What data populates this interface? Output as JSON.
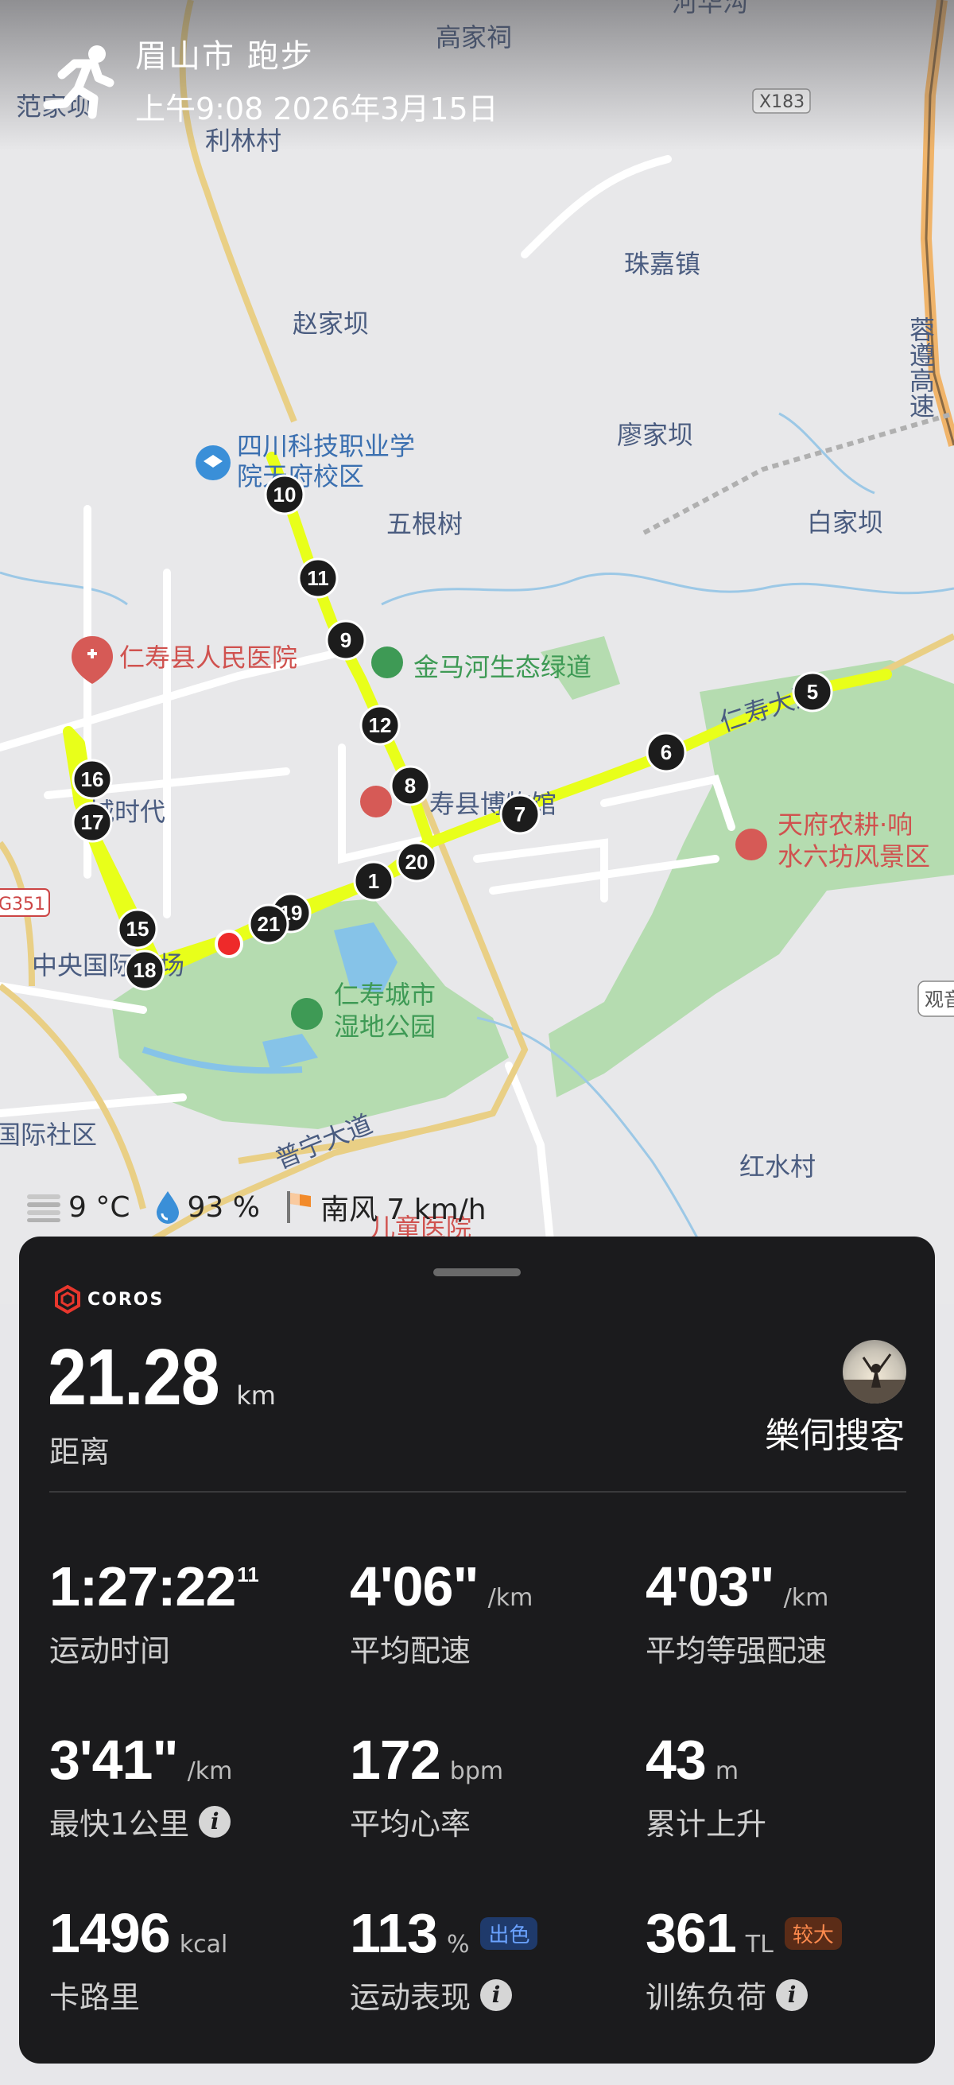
{
  "header": {
    "title": "眉山市 跑步",
    "datetime": "上午9:08 2026年3月15日"
  },
  "map": {
    "place_labels": [
      "高家祠",
      "河华沟",
      "范家坝",
      "利林村",
      "X183",
      "珠嘉镇",
      "赵家坝",
      "蓉遵高速",
      "四川科技职业学",
      "院天府校区",
      "廖家坝",
      "五根树",
      "白家坝",
      "仁寿县人民医院",
      "金马河生态绿道",
      "仁寿大道",
      "城时代",
      "寿县博物馆",
      "天府农耕·响",
      "水六坊风景区",
      "G351",
      "中央国际广场",
      "仁寿城市",
      "湿地公园",
      "观音",
      "国际社区",
      "普宁大道",
      "红水村",
      "儿童医院"
    ],
    "km_markers": [
      "1",
      "5",
      "6",
      "7",
      "8",
      "9",
      "10",
      "11",
      "12",
      "15",
      "16",
      "17",
      "18",
      "19",
      "20",
      "21"
    ],
    "route_color": "#e8ff1a",
    "start_marker_color": "#ee2a2a"
  },
  "weather": {
    "temperature": "9 °C",
    "humidity": "93 %",
    "wind": "南风 7 km/h"
  },
  "summary": {
    "brand": "COROS",
    "distance_value": "21.28",
    "distance_unit": "km",
    "distance_label": "距离",
    "username": "樂伺搜客"
  },
  "metrics": [
    {
      "value": "1:27:22",
      "sup": "11",
      "unit": "",
      "label": "运动时间",
      "info": false,
      "badge": ""
    },
    {
      "value": "4'06\"",
      "sup": "",
      "unit": "/km",
      "label": "平均配速",
      "info": false,
      "badge": ""
    },
    {
      "value": "4'03\"",
      "sup": "",
      "unit": "/km",
      "label": "平均等强配速",
      "info": false,
      "badge": ""
    },
    {
      "value": "3'41\"",
      "sup": "",
      "unit": "/km",
      "label": "最快1公里",
      "info": true,
      "badge": ""
    },
    {
      "value": "172",
      "sup": "",
      "unit": "bpm",
      "label": "平均心率",
      "info": false,
      "badge": ""
    },
    {
      "value": "43",
      "sup": "",
      "unit": "m",
      "label": "累计上升",
      "info": false,
      "badge": ""
    },
    {
      "value": "1496",
      "sup": "",
      "unit": "kcal",
      "label": "卡路里",
      "info": false,
      "badge": ""
    },
    {
      "value": "113",
      "sup": "",
      "unit": "%",
      "label": "运动表现",
      "info": true,
      "badge": "出色"
    },
    {
      "value": "361",
      "sup": "",
      "unit": "TL",
      "label": "训练负荷",
      "info": true,
      "badge": "较大"
    }
  ]
}
